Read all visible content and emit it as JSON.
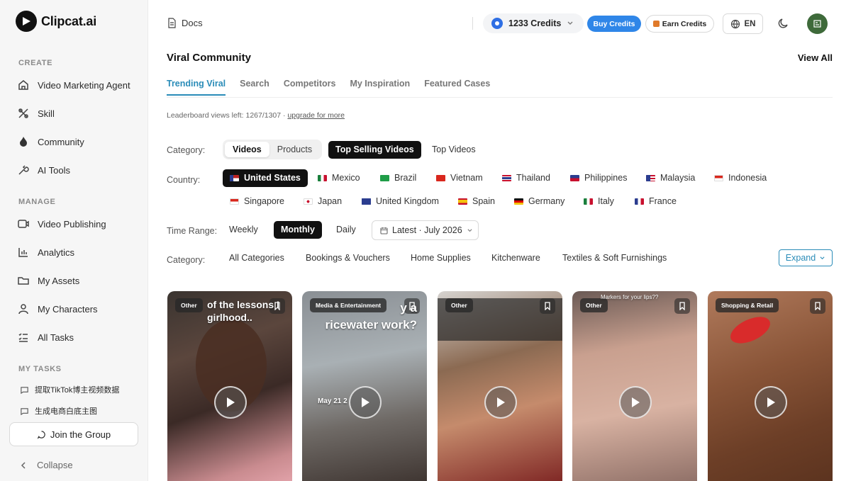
{
  "app": {
    "logo_text": "Clipcat.ai"
  },
  "sidebar": {
    "create_label": "CREATE",
    "create_items": [
      {
        "label": "Video Marketing Agent",
        "icon": "home-icon"
      },
      {
        "label": "Skill",
        "icon": "skill-icon"
      },
      {
        "label": "Community",
        "icon": "fire-icon"
      },
      {
        "label": "AI Tools",
        "icon": "tools-icon"
      }
    ],
    "manage_label": "MANAGE",
    "manage_items": [
      {
        "label": "Video Publishing",
        "icon": "video-icon"
      },
      {
        "label": "Analytics",
        "icon": "chart-icon"
      },
      {
        "label": "My Assets",
        "icon": "folder-icon"
      },
      {
        "label": "My Characters",
        "icon": "user-icon"
      },
      {
        "label": "All Tasks",
        "icon": "tasks-icon"
      }
    ],
    "tasks_label": "MY TASKS",
    "tasks": [
      "提取TikTok博主视频数据",
      "生成电商白底主图"
    ],
    "join_label": "Join the Group",
    "collapse_label": "Collapse"
  },
  "header": {
    "docs_label": "Docs",
    "credits": "1233 Credits",
    "buy_label": "Buy Credits",
    "earn_label": "Earn Credits",
    "lang_label": "EN"
  },
  "main": {
    "title": "Viral Community",
    "view_all": "View All",
    "tabs": [
      "Trending Viral",
      "Search",
      "Competitors",
      "My Inspiration",
      "Featured Cases"
    ],
    "leaderboard_text": "Leaderboard views left: 1267/1307 · ",
    "upgrade_text": "upgrade for more",
    "category_label": "Category:",
    "category_options": [
      "Videos",
      "Products"
    ],
    "ranking_options": [
      "Top Selling Videos",
      "Top Videos"
    ],
    "country_label": "Country:",
    "countries": [
      "United States",
      "Mexico",
      "Brazil",
      "Vietnam",
      "Thailand",
      "Philippines",
      "Malaysia",
      "Indonesia",
      "Singapore",
      "Japan",
      "United Kingdom",
      "Spain",
      "Germany",
      "Italy",
      "France"
    ],
    "time_label": "Time Range:",
    "time_options": [
      "Weekly",
      "Monthly",
      "Daily"
    ],
    "date_value": "Latest · July 2026",
    "category2_label": "Category:",
    "categories": [
      "All Categories",
      "Bookings & Vouchers",
      "Home Supplies",
      "Kitchenware",
      "Textiles & Soft Furnishings"
    ],
    "expand_label": "Expand"
  },
  "cards": [
    {
      "badge": "Other",
      "caption": "of the lessons I\ngirlhood.."
    },
    {
      "badge": "Media & Entertainment",
      "caption": "y a\nricewater work?",
      "date": "May 21 2"
    },
    {
      "badge": "Other",
      "caption": ""
    },
    {
      "badge": "Other",
      "caption": "Markers for your lips??"
    },
    {
      "badge": "Shopping & Retail",
      "caption": ""
    }
  ]
}
